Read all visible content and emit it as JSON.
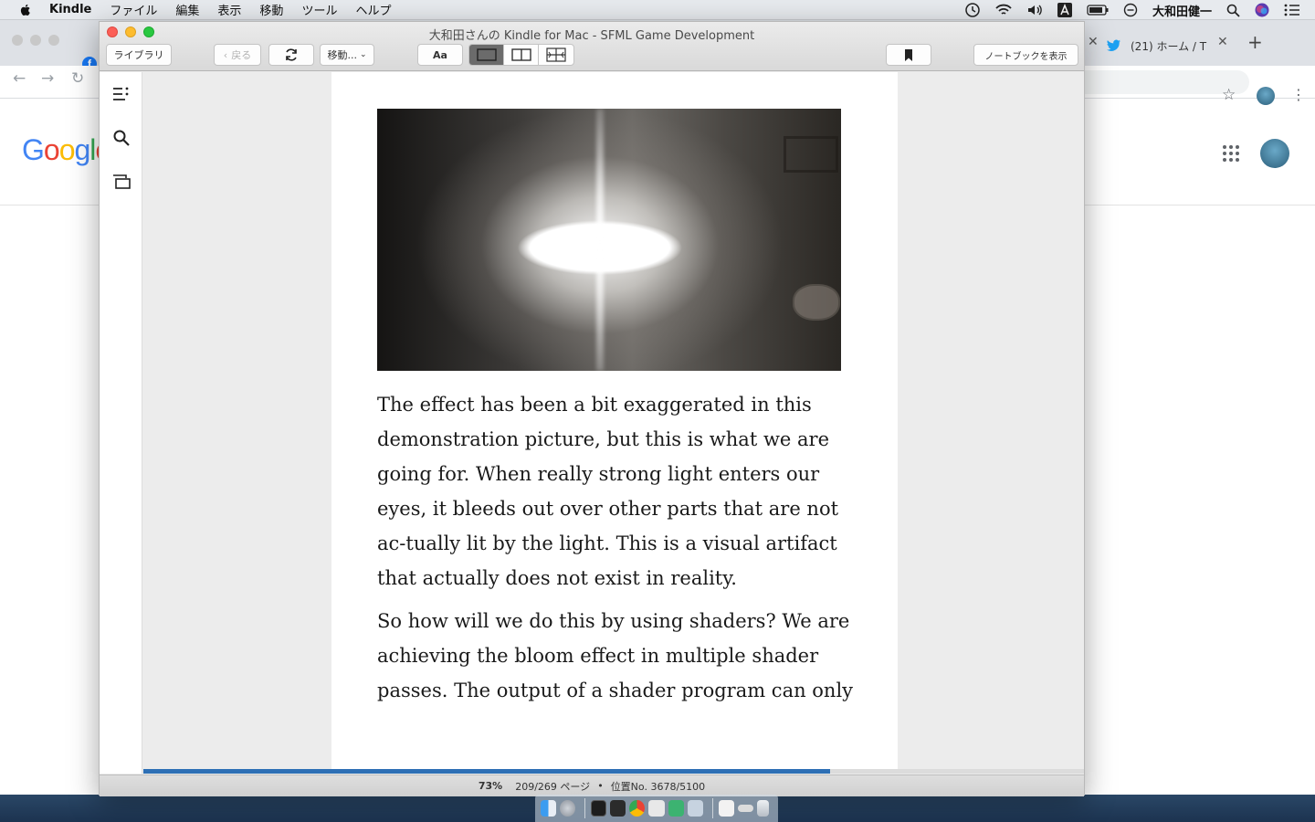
{
  "menubar": {
    "app_name": "Kindle",
    "items": [
      "ファイル",
      "編集",
      "表示",
      "移動",
      "ツール",
      "ヘルプ"
    ],
    "user_name": "大和田健一"
  },
  "chrome": {
    "twitter_tab_title": "(21) ホーム / T",
    "logo_letters": [
      "G",
      "o",
      "o",
      "g",
      "l",
      "e"
    ]
  },
  "kindle": {
    "window_title": "大和田さんの Kindle for Mac - SFML Game Development",
    "toolbar": {
      "library": "ライブラリ",
      "back": "戻る",
      "goto": "移動...",
      "font": "Aa",
      "notebook": "ノートブックを表示"
    },
    "sidebar": [
      "toc-icon",
      "search-icon",
      "flashcards-icon"
    ],
    "content": {
      "paragraphs": [
        "The effect has been a bit exaggerated in this demonstration picture, but this is what we are going for. When really strong light enters our eyes, it bleeds out over other parts that are not ac-tually lit by the light. This is a visual artifact that actually does not exist in reality.",
        "So how will we do this by using shaders? We are achieving the bloom effect in multiple shader passes. The output of a shader program can only"
      ]
    },
    "status": {
      "percent": "73%",
      "pages": "209/269 ページ",
      "bullet": "•",
      "location": "位置No. 3678/5100",
      "progress_fraction": 0.73
    }
  },
  "colors": {
    "progress": "#2d6fb5",
    "close": "#fc5f57",
    "minimize": "#fdbc2e",
    "zoom": "#29c840"
  }
}
